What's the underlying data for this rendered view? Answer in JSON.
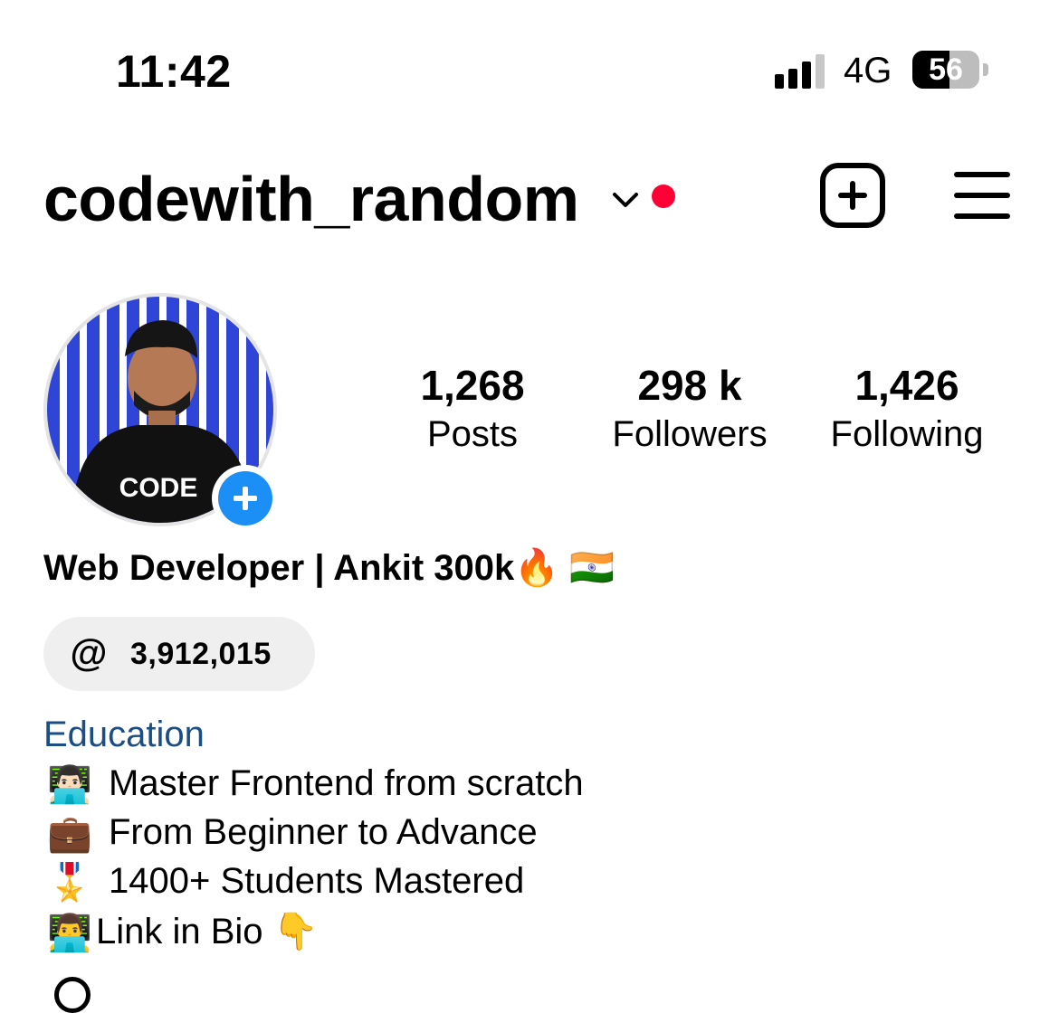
{
  "status_bar": {
    "time": "11:42",
    "network": "4G",
    "battery": "56",
    "battery_level": 0.56,
    "signal_bars": 3
  },
  "header": {
    "username": "codewith_random",
    "live_dot_color": "#ff0034",
    "icons": [
      "chevron-down-icon",
      "new-post-icon",
      "menu-icon"
    ]
  },
  "profile": {
    "avatar_alt": "profile photo",
    "stats": [
      {
        "value": "1,268",
        "label": "Posts"
      },
      {
        "value": "298 k",
        "label": "Followers"
      },
      {
        "value": "1,426",
        "label": "Following"
      }
    ],
    "display_name": "Web Developer | Ankit 300k🔥 🇮🇳",
    "threads": {
      "icon": "threads-icon",
      "count": "3,912,015"
    },
    "category": "Education",
    "bio": [
      {
        "emoji": "👨🏻‍💻",
        "text": "Master Frontend from scratch"
      },
      {
        "emoji": "💼",
        "text": "From Beginner to Advance"
      },
      {
        "emoji": "🎖️",
        "text": "1400+ Students Mastered"
      },
      {
        "emoji": "👨‍💻",
        "text": "Link in Bio 👇"
      }
    ],
    "accent_color": "#1b8ff5",
    "category_color": "#1b4e85"
  }
}
